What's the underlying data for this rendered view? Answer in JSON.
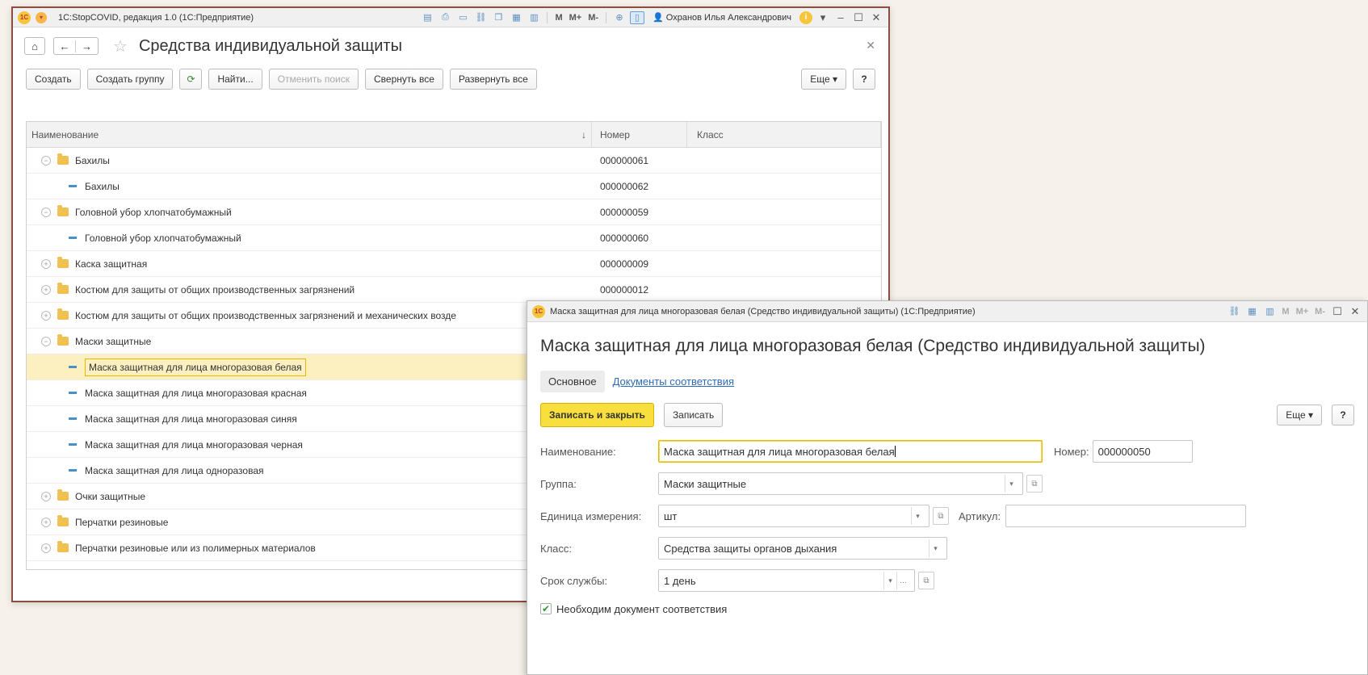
{
  "main_window": {
    "title": "1С:StopCOVID, редакция 1.0  (1С:Предприятие)",
    "user": "Охранов Илья Александрович",
    "toolbar_labels": {
      "m": "M",
      "mplus": "M+",
      "mminus": "M-"
    },
    "form_title": "Средства индивидуальной защиты",
    "buttons": {
      "create": "Создать",
      "create_group": "Создать группу",
      "find": "Найти...",
      "cancel_search": "Отменить поиск",
      "collapse_all": "Свернуть все",
      "expand_all": "Развернуть все",
      "more": "Еще",
      "help": "?"
    },
    "columns": {
      "name": "Наименование",
      "sort": "↓",
      "number": "Номер",
      "class": "Класс"
    },
    "rows": [
      {
        "kind": "group",
        "state": "open",
        "name": "Бахилы",
        "number": "000000061"
      },
      {
        "kind": "item",
        "name": "Бахилы",
        "number": "000000062"
      },
      {
        "kind": "group",
        "state": "open",
        "name": "Головной убор хлопчатобумажный",
        "number": "000000059"
      },
      {
        "kind": "item",
        "name": "Головной убор хлопчатобумажный",
        "number": "000000060"
      },
      {
        "kind": "group",
        "state": "closed",
        "name": "Каска защитная",
        "number": "000000009"
      },
      {
        "kind": "group",
        "state": "closed",
        "name": "Костюм для защиты от общих производственных загрязнений",
        "number": "000000012"
      },
      {
        "kind": "group",
        "state": "closed",
        "name": "Костюм для защиты от общих производственных загрязнений и механических возде",
        "number": ""
      },
      {
        "kind": "group",
        "state": "open",
        "name": "Маски защитные",
        "number": ""
      },
      {
        "kind": "item",
        "selected": true,
        "name": "Маска защитная для лица многоразовая белая",
        "number": ""
      },
      {
        "kind": "item",
        "name": "Маска защитная для лица многоразовая красная",
        "number": ""
      },
      {
        "kind": "item",
        "name": "Маска защитная для лица многоразовая синяя",
        "number": ""
      },
      {
        "kind": "item",
        "name": "Маска защитная для лица многоразовая черная",
        "number": ""
      },
      {
        "kind": "item",
        "name": "Маска защитная для лица одноразовая",
        "number": ""
      },
      {
        "kind": "group",
        "state": "closed",
        "name": "Очки защитные",
        "number": ""
      },
      {
        "kind": "group",
        "state": "closed",
        "name": "Перчатки резиновые",
        "number": ""
      },
      {
        "kind": "group",
        "state": "closed",
        "name": "Перчатки резиновые или из полимерных материалов",
        "number": ""
      }
    ]
  },
  "item_window": {
    "title": "Маска защитная для лица многоразовая белая (Средство индивидуальной защиты)  (1С:Предприятие)",
    "form_title": "Маска защитная для лица многоразовая белая (Средство индивидуальной защиты)",
    "tabs": {
      "main": "Основное",
      "docs": "Документы соответствия"
    },
    "buttons": {
      "save_close": "Записать и закрыть",
      "save": "Записать",
      "more": "Еще",
      "help": "?"
    },
    "labels": {
      "name": "Наименование:",
      "number": "Номер:",
      "group": "Группа:",
      "unit": "Единица измерения:",
      "article": "Артикул:",
      "class": "Класс:",
      "service_life": "Срок службы:",
      "needs_doc": "Необходим документ соответствия"
    },
    "values": {
      "name": "Маска защитная для лица многоразовая белая",
      "number": "000000050",
      "group": "Маски защитные",
      "unit": "шт",
      "article": "",
      "class": "Средства защиты органов дыхания",
      "service_life": "1 день",
      "needs_doc": true
    }
  }
}
